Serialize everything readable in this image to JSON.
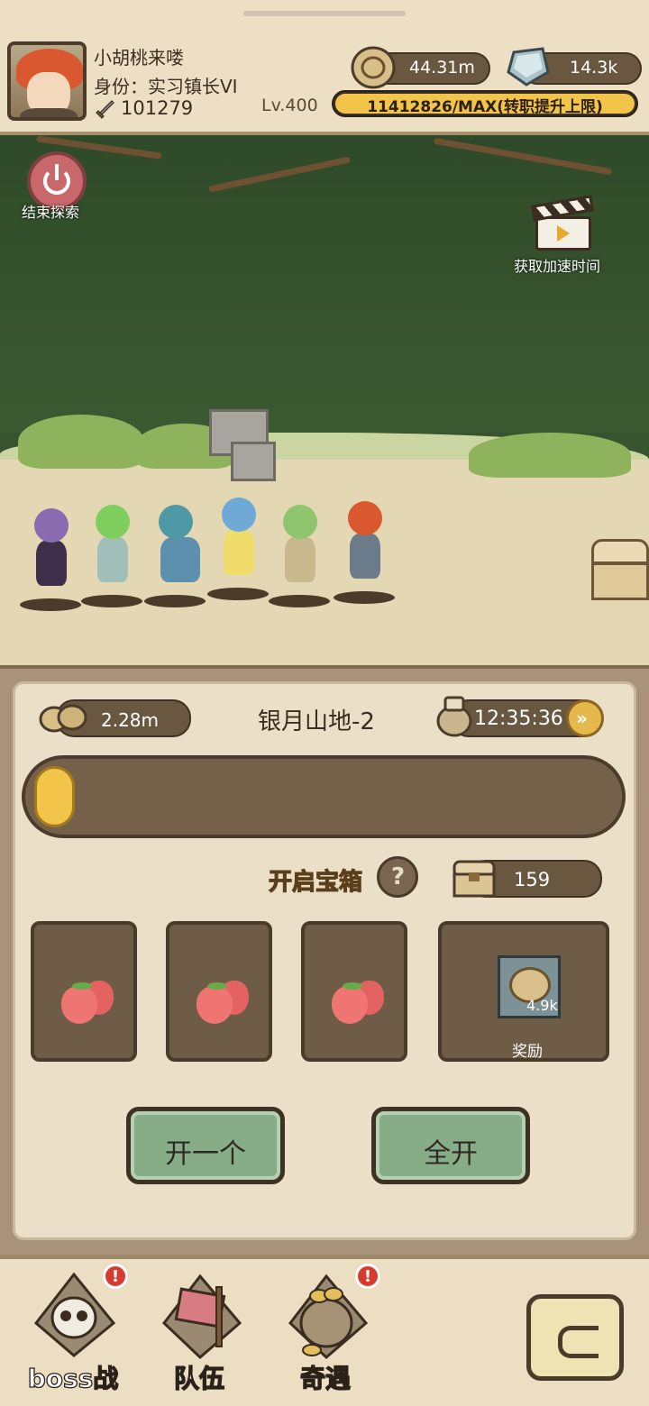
{
  "header": {
    "player_name": "小胡桃来喽",
    "player_title": "身份：实习镇长VI",
    "power": "101279",
    "level": "Lv.400",
    "coins": "44.31m",
    "gems": "14.3k",
    "exp_text": "11412826/MAX(转职提升上限)",
    "exp_fill_percent": 100
  },
  "scene": {
    "end_explore_label": "结束探索",
    "speedup_label": "获取加速时间"
  },
  "panel": {
    "reward_rate": "2.28m",
    "stage_name": "银月山地-2",
    "timer": "12:35:36",
    "fast_forward_icon": "»",
    "progress_fill_percent": 7,
    "open_chest_label": "开启宝箱",
    "help_icon": "?",
    "chest_count": "159",
    "reward_item_qty": "4.9k",
    "reward_label": "奖励",
    "open_one_label": "开一个",
    "open_all_label": "全开"
  },
  "nav": {
    "boss_label": "boss战",
    "team_label": "队伍",
    "event_label": "奇遇",
    "badge_text": "!"
  },
  "colors": {
    "accent_gold": "#f2c44a",
    "button_green": "#86ad88",
    "badge_red": "#d63b2f",
    "panel_brown": "#6a5740"
  }
}
